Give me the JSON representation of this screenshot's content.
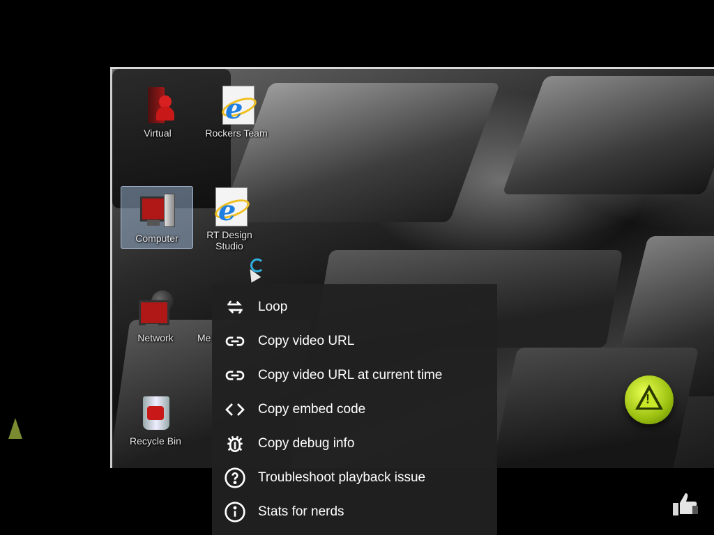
{
  "desktop": {
    "icons": [
      {
        "label": "Virtual"
      },
      {
        "label": "Rockers Team"
      },
      {
        "label": "Computer"
      },
      {
        "label": "RT Design Studio"
      },
      {
        "label": "Network"
      },
      {
        "label": "Me"
      },
      {
        "label": "Recycle Bin"
      }
    ]
  },
  "context_menu": {
    "items": [
      {
        "label": "Loop",
        "icon": "loop-icon"
      },
      {
        "label": "Copy video URL",
        "icon": "link-icon"
      },
      {
        "label": "Copy video URL at current time",
        "icon": "link-icon"
      },
      {
        "label": "Copy embed code",
        "icon": "code-icon"
      },
      {
        "label": "Copy debug info",
        "icon": "bug-icon"
      },
      {
        "label": "Troubleshoot playback issue",
        "icon": "help-circle-icon"
      },
      {
        "label": "Stats for nerds",
        "icon": "info-circle-icon"
      }
    ]
  },
  "colors": {
    "menu_bg": "#212121",
    "menu_text": "#ffffff",
    "page_bg": "#000000"
  }
}
